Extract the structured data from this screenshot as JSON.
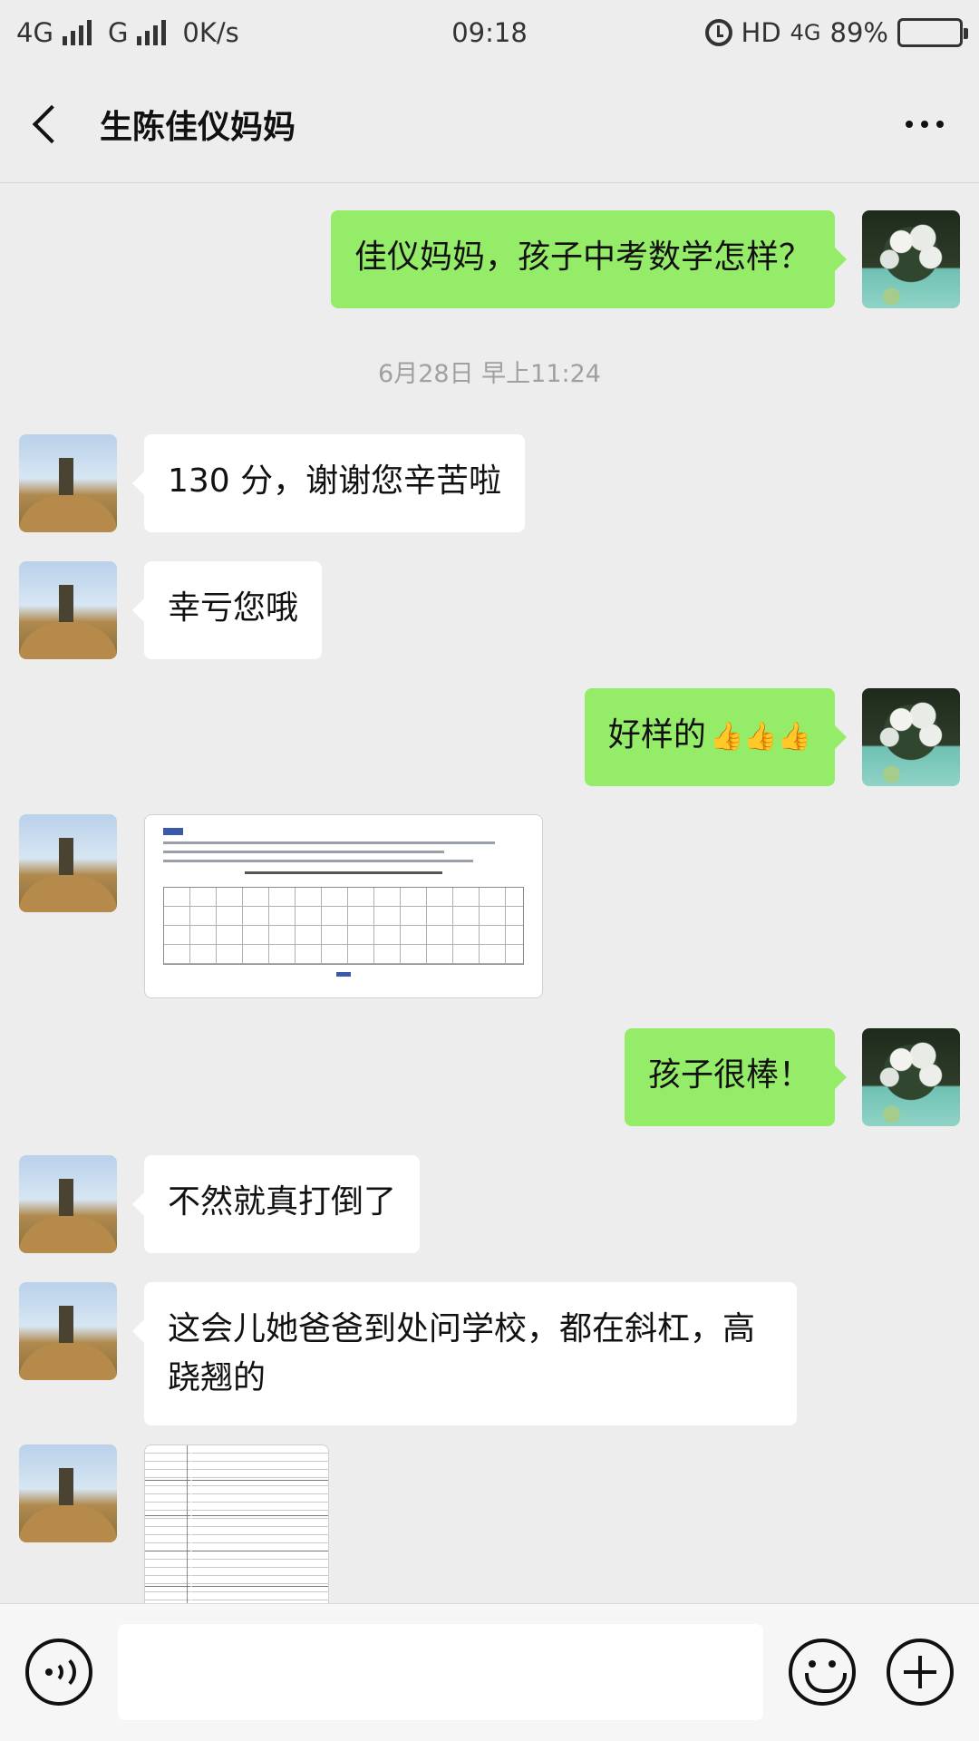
{
  "status_bar": {
    "network1": "4G",
    "network2": "G",
    "speed": "0K/s",
    "time": "09:18",
    "hd": "HD",
    "network3": "4G",
    "battery": "89%",
    "battery_level": 0.89
  },
  "header": {
    "title": "生陈佳仪妈妈"
  },
  "timestamp": "6月28日 早上11:24",
  "messages": [
    {
      "side": "out",
      "text": "佳仪妈妈，孩子中考数学怎样？"
    },
    {
      "side": "in",
      "text": "130 分，谢谢您辛苦啦"
    },
    {
      "side": "in",
      "text": "幸亏您哦"
    },
    {
      "side": "out",
      "text": "好样的",
      "emoji": "👍👍👍"
    },
    {
      "side": "in",
      "type": "image",
      "icon": "score-report-document"
    },
    {
      "side": "out",
      "text": "孩子很棒！"
    },
    {
      "side": "in",
      "text": "不然就真打倒了"
    },
    {
      "side": "in",
      "text": "这会儿她爸爸到处问学校，都在斜杠，高跷翘的"
    },
    {
      "side": "in",
      "type": "image",
      "icon": "school-list-document"
    }
  ],
  "input": {
    "value": ""
  },
  "colors": {
    "background": "#ededed",
    "outgoing_bubble": "#95ec69",
    "incoming_bubble": "#ffffff"
  }
}
